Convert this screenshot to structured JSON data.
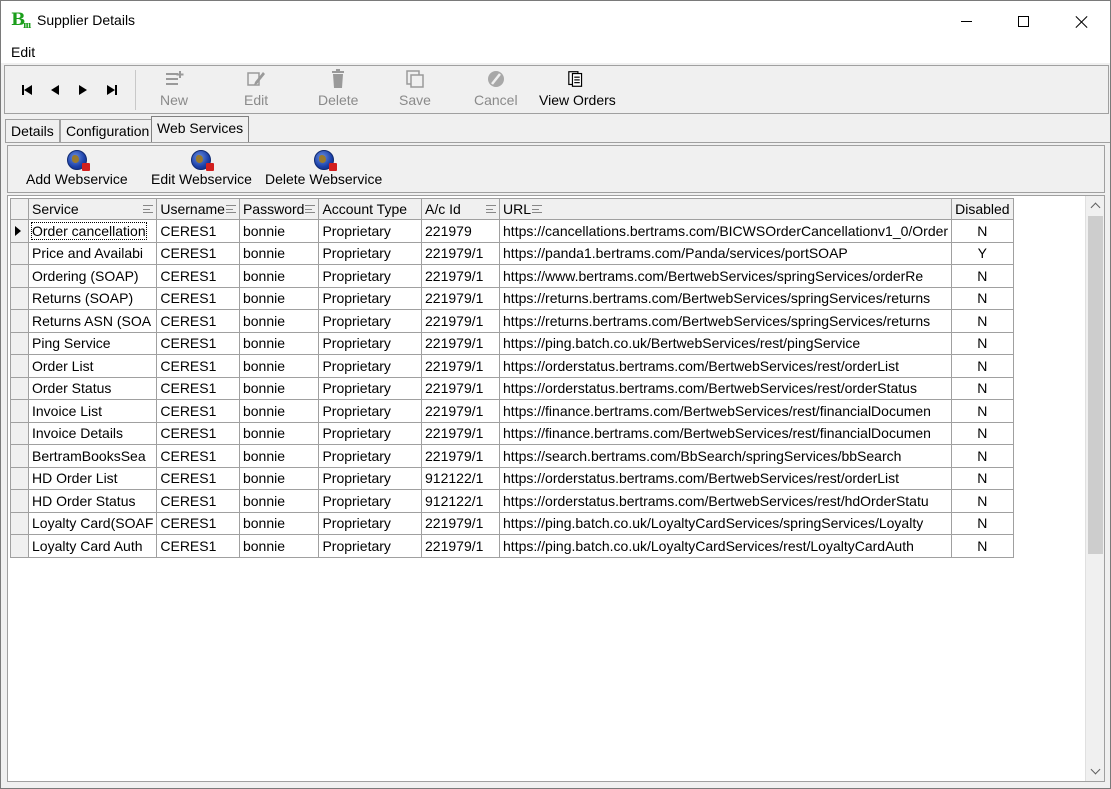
{
  "window": {
    "title": "Supplier Details",
    "logo_text": "B",
    "logo_sub": "ııı"
  },
  "menu": {
    "items": [
      "Edit"
    ]
  },
  "toolbar": {
    "new_label": "New",
    "edit_label": "Edit",
    "delete_label": "Delete",
    "save_label": "Save",
    "cancel_label": "Cancel",
    "view_orders_label": "View Orders"
  },
  "tabs": [
    {
      "label": "Details",
      "active": false
    },
    {
      "label": "Configuration",
      "active": false
    },
    {
      "label": "Web Services",
      "active": true
    }
  ],
  "webservices_toolbar": {
    "add_label": "Add Webservice",
    "edit_label": "Edit Webservice",
    "delete_label": "Delete Webservice"
  },
  "grid": {
    "columns": [
      "Service",
      "Username",
      "Password",
      "Account Type",
      "A/c Id",
      "URL",
      "Disabled"
    ],
    "rows": [
      [
        "Order cancellation",
        "CERES1",
        "bonnie",
        "Proprietary",
        "221979",
        "https://cancellations.bertrams.com/BICWSOrderCancellationv1_0/Order",
        "N"
      ],
      [
        "Price and Availabi",
        "CERES1",
        "bonnie",
        "Proprietary",
        "221979/1",
        "https://panda1.bertrams.com/Panda/services/portSOAP",
        "Y"
      ],
      [
        "Ordering (SOAP)",
        "CERES1",
        "bonnie",
        "Proprietary",
        "221979/1",
        "https://www.bertrams.com/BertwebServices/springServices/orderRe",
        "N"
      ],
      [
        "Returns (SOAP)",
        "CERES1",
        "bonnie",
        "Proprietary",
        "221979/1",
        "https://returns.bertrams.com/BertwebServices/springServices/returns",
        "N"
      ],
      [
        "Returns ASN (SOA",
        "CERES1",
        "bonnie",
        "Proprietary",
        "221979/1",
        "https://returns.bertrams.com/BertwebServices/springServices/returns",
        "N"
      ],
      [
        "Ping Service",
        "CERES1",
        "bonnie",
        "Proprietary",
        "221979/1",
        "https://ping.batch.co.uk/BertwebServices/rest/pingService",
        "N"
      ],
      [
        "Order List",
        "CERES1",
        "bonnie",
        "Proprietary",
        "221979/1",
        "https://orderstatus.bertrams.com/BertwebServices/rest/orderList",
        "N"
      ],
      [
        "Order Status",
        "CERES1",
        "bonnie",
        "Proprietary",
        "221979/1",
        "https://orderstatus.bertrams.com/BertwebServices/rest/orderStatus",
        "N"
      ],
      [
        "Invoice List",
        "CERES1",
        "bonnie",
        "Proprietary",
        "221979/1",
        "https://finance.bertrams.com/BertwebServices/rest/financialDocumen",
        "N"
      ],
      [
        "Invoice Details",
        "CERES1",
        "bonnie",
        "Proprietary",
        "221979/1",
        "https://finance.bertrams.com/BertwebServices/rest/financialDocumen",
        "N"
      ],
      [
        "BertramBooksSea",
        "CERES1",
        "bonnie",
        "Proprietary",
        "221979/1",
        "https://search.bertrams.com/BbSearch/springServices/bbSearch",
        "N"
      ],
      [
        "HD Order List",
        "CERES1",
        "bonnie",
        "Proprietary",
        "912122/1",
        "https://orderstatus.bertrams.com/BertwebServices/rest/orderList",
        "N"
      ],
      [
        "HD Order Status",
        "CERES1",
        "bonnie",
        "Proprietary",
        "912122/1",
        "https://orderstatus.bertrams.com/BertwebServices/rest/hdOrderStatu",
        "N"
      ],
      [
        "Loyalty Card(SOAF",
        "CERES1",
        "bonnie",
        "Proprietary",
        "221979/1",
        "https://ping.batch.co.uk/LoyaltyCardServices/springServices/Loyalty",
        "N"
      ],
      [
        "Loyalty Card Auth",
        "CERES1",
        "bonnie",
        "Proprietary",
        "221979/1",
        "https://ping.batch.co.uk/LoyaltyCardServices/rest/LoyaltyCardAuth",
        "N"
      ]
    ],
    "selected_row": 0
  },
  "colors": {
    "window_bg": "#f0f0f0",
    "disabled_text": "#8a8a8a",
    "grid_line": "#a0a0a0",
    "logo_green": "#1b9e1b"
  }
}
